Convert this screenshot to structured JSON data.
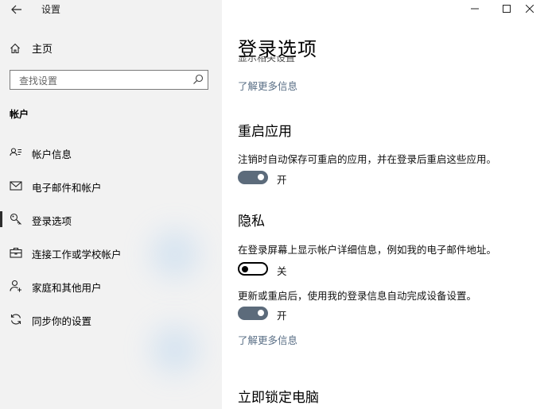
{
  "window": {
    "app_title": "设置",
    "minimize_glyph": "—",
    "maximize_glyph": "☐",
    "close_glyph": "✕"
  },
  "sidebar": {
    "home_label": "主页",
    "search_placeholder": "查找设置",
    "section_title": "帐户",
    "items": [
      {
        "label": "帐户信息",
        "icon": "person-card-icon",
        "selected": false
      },
      {
        "label": "电子邮件和帐户",
        "icon": "mail-icon",
        "selected": false
      },
      {
        "label": "登录选项",
        "icon": "key-icon",
        "selected": true
      },
      {
        "label": "连接工作或学校帐户",
        "icon": "briefcase-icon",
        "selected": false
      },
      {
        "label": "家庭和其他用户",
        "icon": "person-add-icon",
        "selected": false
      },
      {
        "label": "同步你的设置",
        "icon": "sync-icon",
        "selected": false
      }
    ]
  },
  "main": {
    "title": "登录选项",
    "clipped_text": "显示相关设置",
    "learn_more_1": "了解更多信息",
    "restart_apps": {
      "heading": "重启应用",
      "description": "注销时自动保存可重启的应用，并在登录后重启这些应用。",
      "toggle_state": "开",
      "on": true
    },
    "privacy": {
      "heading": "隐私",
      "option1_description": "在登录屏幕上显示帐户详细信息，例如我的电子邮件地址。",
      "option1_state": "关",
      "option1_on": false,
      "option2_description": "更新或重启后，使用我的登录信息自动完成设备设置。",
      "option2_state": "开",
      "option2_on": true,
      "learn_more": "了解更多信息"
    },
    "lock_heading": "立即锁定电脑"
  },
  "colors": {
    "sidebar_bg": "#f2f2f2",
    "toggle_on": "#5c6b7b",
    "link": "#5a6f86"
  }
}
